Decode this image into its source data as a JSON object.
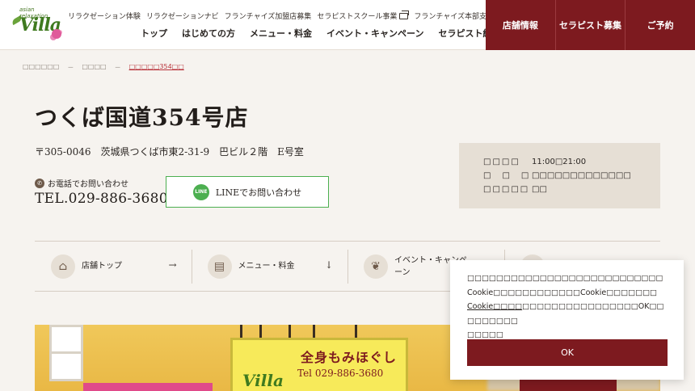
{
  "header": {
    "logo": {
      "tagline": "asian relaxation",
      "word": "Villa"
    },
    "top_links": [
      {
        "label": "リラクゼーション体験",
        "external": false
      },
      {
        "label": "リラクゼーションナビ",
        "external": false
      },
      {
        "label": "フランチャイズ加盟店募集",
        "external": false
      },
      {
        "label": "セラピストスクール事業",
        "external": true
      },
      {
        "label": "フランチャイズ本部支援",
        "external": true
      }
    ],
    "main_links": [
      "トップ",
      "はじめての方",
      "メニュー・料金",
      "イベント・キャンペーン",
      "セラピスト紹介"
    ],
    "red_buttons": [
      "店舗情報",
      "セラピスト募集",
      "ご予約"
    ]
  },
  "breadcrumb": {
    "items": [
      "□□□□□□",
      "□□□□",
      "□□□□□354□□"
    ],
    "separator": "－"
  },
  "store": {
    "title": "つくば国道354号店",
    "address": "〒305-0046　茨城県つくば市東2-31-9　巴ビル２階　E号室",
    "tel_label": "お電話でお問い合わせ",
    "tel": "TEL.029-886-3680",
    "line_button": "LINEでお問い合わせ",
    "line_icon_text": "LINE"
  },
  "hours": {
    "rows": [
      {
        "key": "□□□□",
        "value": "11:00□21:00"
      },
      {
        "key": "□　□　□",
        "value": "□□□□□□□□□□□□□"
      },
      {
        "key": "□□□□□",
        "value": "□□"
      }
    ]
  },
  "tabs": [
    {
      "label": "店舗トップ",
      "icon": "store-icon",
      "arrow": "→"
    },
    {
      "label": "メニュー・料金",
      "icon": "document-icon",
      "arrow": "↓"
    },
    {
      "label": "イベント・キャンペーン",
      "icon": "leaf-icon",
      "arrow": ""
    },
    {
      "label": "",
      "icon": "person-icon",
      "arrow": ""
    }
  ],
  "photo": {
    "sign_main": "全身もみほぐし",
    "sign_tel": "Tel 029-886-3680",
    "sign_villa": "Villa"
  },
  "cookie": {
    "line1": "□□□□□□□□□□□□□□□□□□□□□□□□□□□",
    "line2": "Cookie□□□□□□□□□□□□Cookie□□□□□□□",
    "link": "Cookie□□□□",
    "line3": "□□□□□□□□□□□□□□□□OK□□□□□□□□□",
    "line4": "□□□□□",
    "ok": "OK"
  },
  "colors": {
    "brand_red": "#7d1a1f",
    "line_green": "#4caf50",
    "beige": "#e6dfd5"
  }
}
